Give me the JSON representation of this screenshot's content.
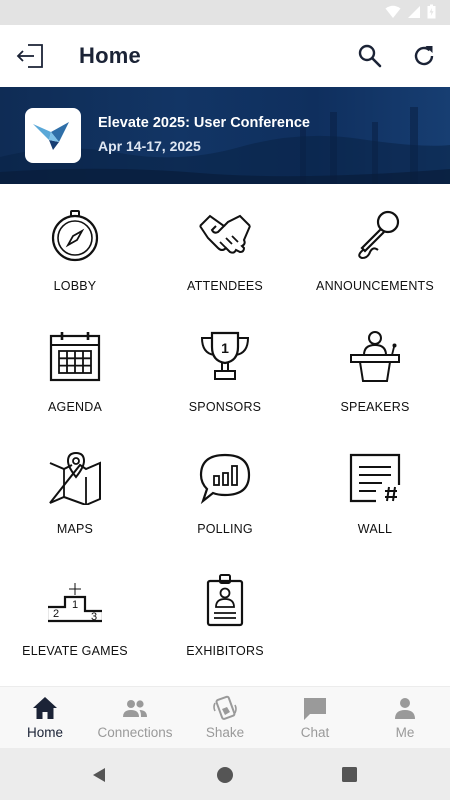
{
  "header": {
    "title": "Home"
  },
  "event": {
    "name": "Elevate 2025: User Conference",
    "dates": "Apr 14-17, 2025"
  },
  "tiles": [
    {
      "label": "LOBBY",
      "icon": "compass-icon"
    },
    {
      "label": "ATTENDEES",
      "icon": "handshake-icon"
    },
    {
      "label": "ANNOUNCEMENTS",
      "icon": "microphone-icon"
    },
    {
      "label": "AGENDA",
      "icon": "calendar-icon"
    },
    {
      "label": "SPONSORS",
      "icon": "trophy-icon"
    },
    {
      "label": "SPEAKERS",
      "icon": "podium-speaker-icon"
    },
    {
      "label": "MAPS",
      "icon": "map-icon"
    },
    {
      "label": "POLLING",
      "icon": "poll-chat-icon"
    },
    {
      "label": "WALL",
      "icon": "wall-post-icon"
    },
    {
      "label": "ELEVATE GAMES",
      "icon": "winners-podium-icon"
    },
    {
      "label": "EXHIBITORS",
      "icon": "badge-icon"
    }
  ],
  "nav": [
    {
      "label": "Home",
      "icon": "home-icon",
      "active": true
    },
    {
      "label": "Connections",
      "icon": "people-icon",
      "active": false
    },
    {
      "label": "Shake",
      "icon": "shake-phone-icon",
      "active": false
    },
    {
      "label": "Chat",
      "icon": "chat-icon",
      "active": false
    },
    {
      "label": "Me",
      "icon": "person-icon",
      "active": false
    }
  ],
  "colors": {
    "header_text": "#1b2336",
    "banner": "#123565",
    "inactive_nav": "#9a9a9a"
  }
}
